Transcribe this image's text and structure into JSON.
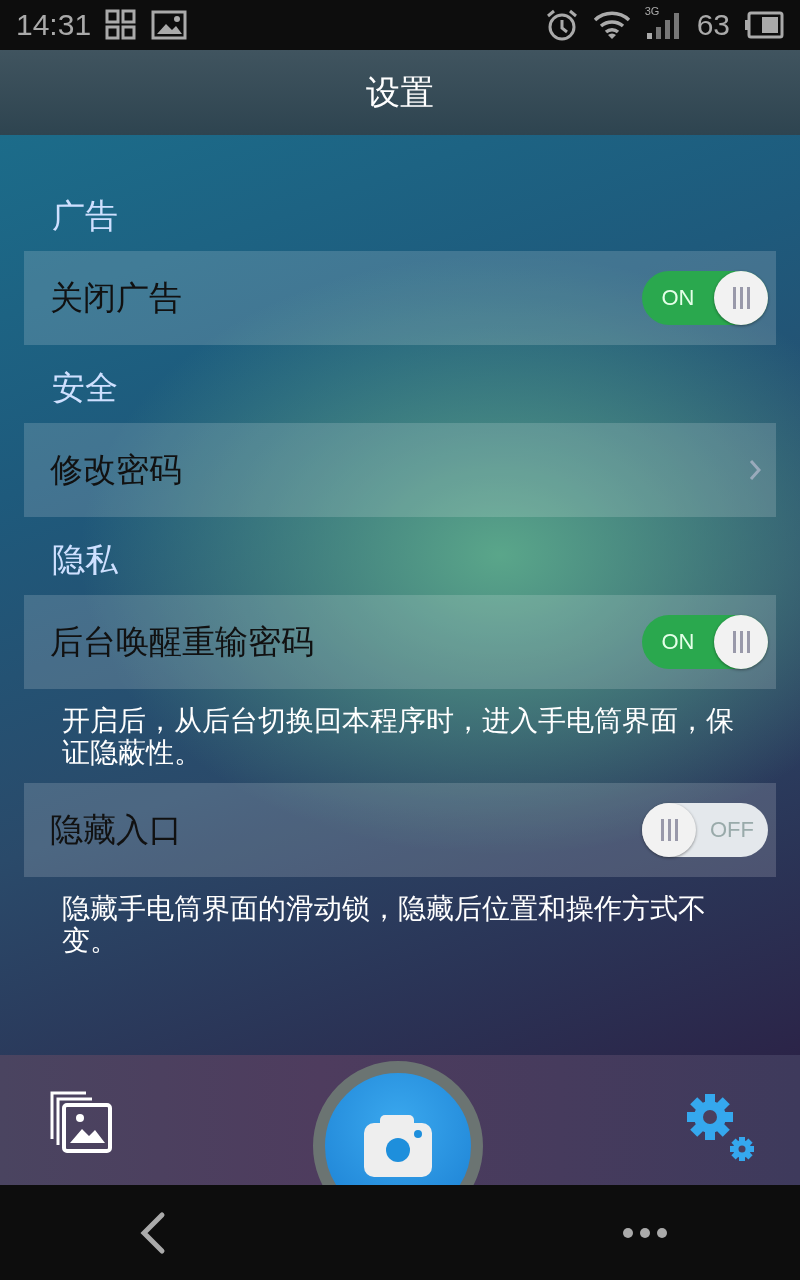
{
  "status_bar": {
    "time": "14:31",
    "network": "3G",
    "battery": "63"
  },
  "title": "设置",
  "sections": [
    {
      "title": "广告",
      "items": [
        {
          "kind": "toggle",
          "label": "关闭广告",
          "on": true,
          "switch_text": "ON"
        }
      ]
    },
    {
      "title": "安全",
      "items": [
        {
          "kind": "link",
          "label": "修改密码"
        }
      ]
    },
    {
      "title": "隐私",
      "items": [
        {
          "kind": "toggle",
          "label": "后台唤醒重输密码",
          "on": true,
          "switch_text": "ON",
          "description": "开启后，从后台切换回本程序时，进入手电筒界面，保证隐蔽性。"
        },
        {
          "kind": "toggle",
          "label": "隐藏入口",
          "on": false,
          "switch_text": "OFF",
          "description": "隐藏手电筒界面的滑动锁，隐藏后位置和操作方式不变。"
        }
      ]
    }
  ]
}
